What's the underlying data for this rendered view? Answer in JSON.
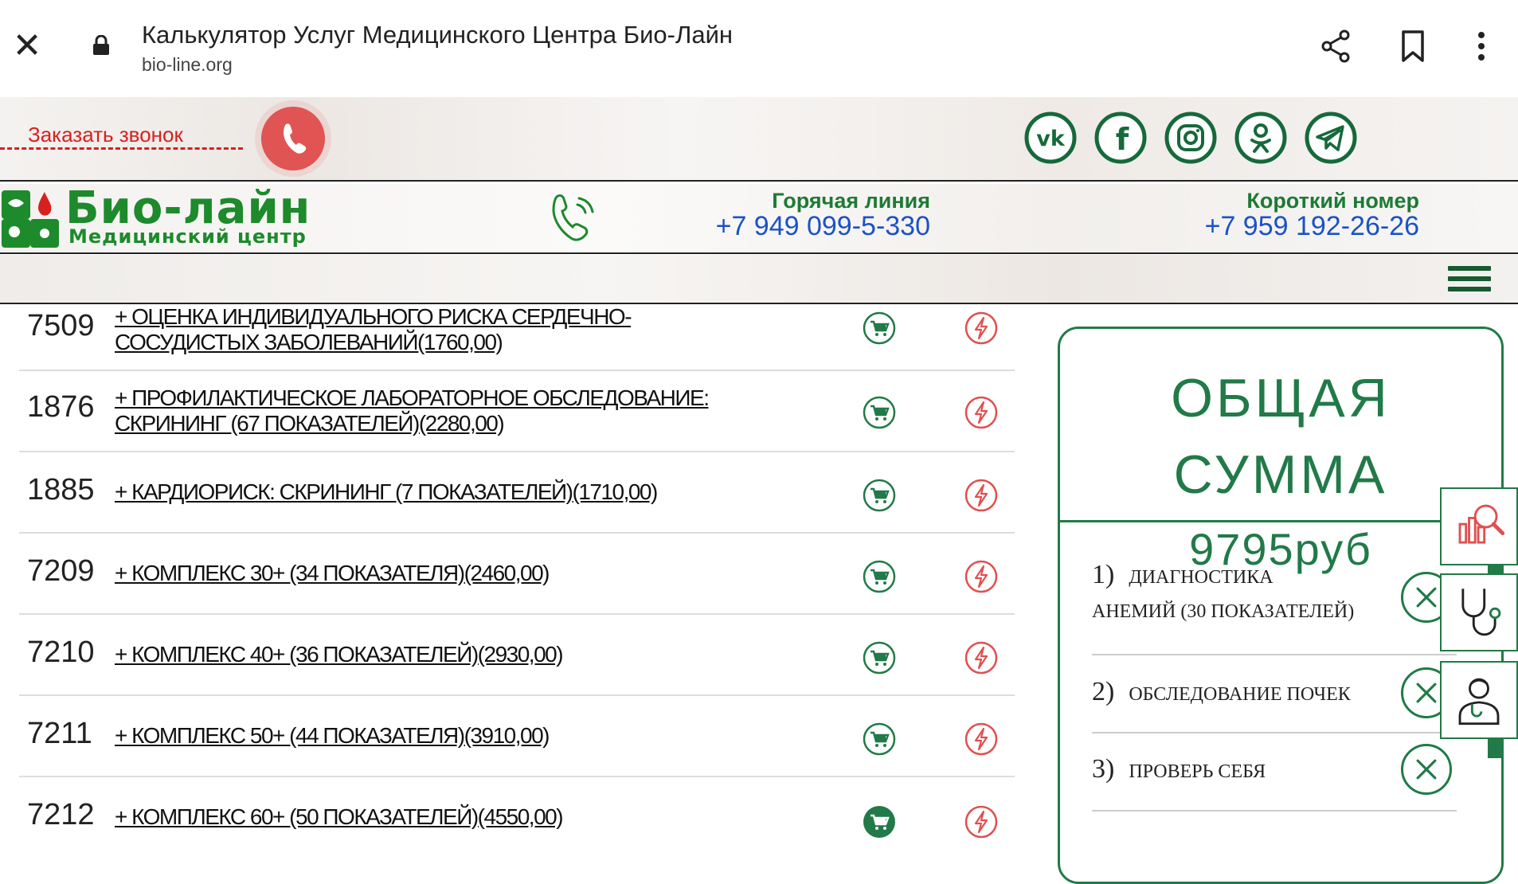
{
  "browser": {
    "title": "Калькулятор Услуг Медицинского Центра Био-Лайн",
    "url": "bio-line.org",
    "close_icon": "close-icon",
    "lock_icon": "lock-icon",
    "actions": [
      "share-icon",
      "bookmark-icon",
      "more-vert-icon"
    ]
  },
  "topbar": {
    "callback_label": "Заказать звонок",
    "social": [
      "vk-icon",
      "facebook-icon",
      "instagram-icon",
      "odnoklassniki-icon",
      "telegram-icon"
    ]
  },
  "header": {
    "logo_name": "Био-лайн",
    "logo_sub": "Медицинский центр",
    "hotline_label": "Горячая линия",
    "hotline_number": "+7 949 099-5-330",
    "short_label": "Короткий номер",
    "short_number": "+7 959 192-26-26"
  },
  "services": [
    {
      "code": "7509",
      "lines": [
        "+ ОЦЕНКА ИНДИВИДУАЛЬНОГО РИСКА СЕРДЕЧНО-",
        "СОСУДИСТЫХ ЗАБОЛЕВАНИЙ(1760,00)"
      ],
      "in_cart": false
    },
    {
      "code": "1876",
      "lines": [
        "+ ПРОФИЛАКТИЧЕСКОЕ ЛАБОРАТОРНОЕ ОБСЛЕДОВАНИЕ:",
        "СКРИНИНГ (67 ПОКАЗАТЕЛЕЙ)(2280,00)"
      ],
      "in_cart": false
    },
    {
      "code": "1885",
      "lines": [
        "+ КАРДИОРИСК: СКРИНИНГ (7 ПОКАЗАТЕЛЕЙ)(1710,00)"
      ],
      "in_cart": false
    },
    {
      "code": "7209",
      "lines": [
        "+ КОМПЛЕКС 30+ (34 ПОКАЗАТЕЛЯ)(2460,00)"
      ],
      "in_cart": false
    },
    {
      "code": "7210",
      "lines": [
        "+ КОМПЛЕКС 40+ (36 ПОКАЗАТЕЛЕЙ)(2930,00)"
      ],
      "in_cart": false
    },
    {
      "code": "7211",
      "lines": [
        "+ КОМПЛЕКС 50+ (44 ПОКАЗАТЕЛЯ)(3910,00)"
      ],
      "in_cart": false
    },
    {
      "code": "7212",
      "lines": [
        "+ КОМПЛЕКС 60+ (50 ПОКАЗАТЕЛЕЙ)(4550,00)"
      ],
      "in_cart": true
    }
  ],
  "summary": {
    "title_line1": "ОБЩАЯ",
    "title_line2": "СУММА",
    "total": "9795руб",
    "items": [
      {
        "num": "1)",
        "text1": "ДИАГНОСТИКА",
        "text2": "АНЕМИЙ (30 ПОКАЗАТЕЛЕЙ)"
      },
      {
        "num": "2)",
        "text1": "ОБСЛЕДОВАНИЕ ПОЧЕК",
        "text2": ""
      },
      {
        "num": "3)",
        "text1": "ПРОВЕРЬ СЕБЯ",
        "text2": ""
      }
    ]
  },
  "side_tabs": [
    "lab-analysis-icon",
    "stethoscope-icon",
    "doctor-icon"
  ],
  "colors": {
    "brand_green": "#1d8a2c",
    "dark_green": "#217a48",
    "callback_red": "#d72020",
    "phone_blue": "#1b52c4"
  }
}
